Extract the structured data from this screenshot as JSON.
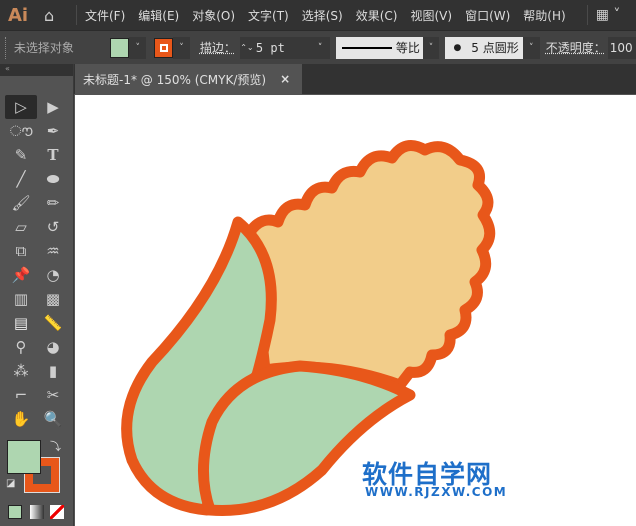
{
  "app": {
    "logo": "Ai"
  },
  "menu": [
    "文件(F)",
    "编辑(E)",
    "对象(O)",
    "文字(T)",
    "选择(S)",
    "效果(C)",
    "视图(V)",
    "窗口(W)",
    "帮助(H)"
  ],
  "control": {
    "selection": "未选择对象",
    "stroke_label": "描边：",
    "stroke_value": "5 pt",
    "profile": "等比",
    "brush": "5 点圆形",
    "opacity_label": "不透明度：",
    "opacity_value": "100"
  },
  "document_tab": {
    "title": "未标题-1* @ 150% (CMYK/预览)",
    "close": "×"
  },
  "colors": {
    "fill": "#aed6b0",
    "stroke": "#e8571a",
    "cob": "#f2cd8a"
  },
  "watermark": {
    "line1": "软件自学网",
    "line2": "WWW.RJZXW.COM"
  }
}
